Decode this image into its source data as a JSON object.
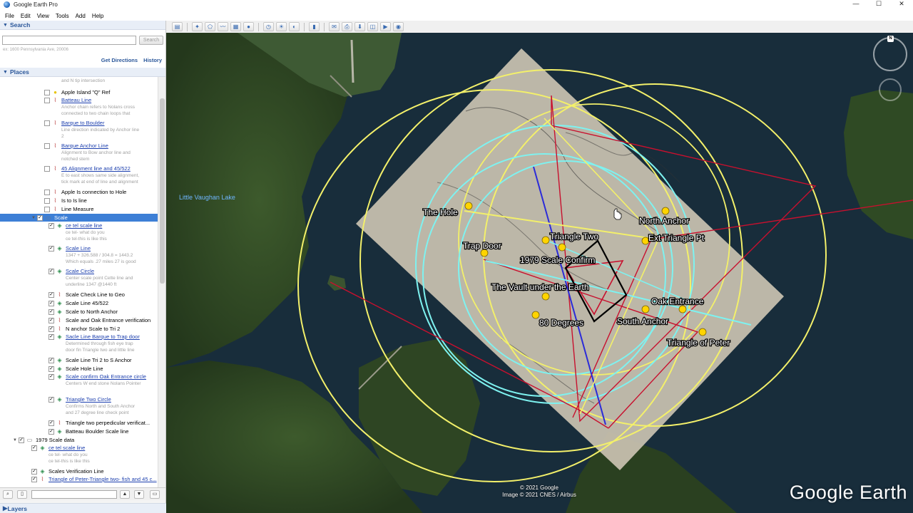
{
  "window": {
    "title": "Google Earth Pro",
    "controls": [
      "—",
      "☐",
      "✕"
    ]
  },
  "menu": [
    "File",
    "Edit",
    "View",
    "Tools",
    "Add",
    "Help"
  ],
  "search": {
    "header": "Search",
    "placeholder": "ex: 1600 Pennsylvania Ave, 20006",
    "button": "Search",
    "get_directions": "Get Directions",
    "history": "History"
  },
  "places": {
    "header": "Places",
    "top_desc": "and N tip intersection",
    "items": [
      {
        "label": "Apple Island \"Q\" Ref",
        "icon": "pin",
        "checked": false,
        "link": false,
        "desc": []
      },
      {
        "label": "Batteau Line",
        "icon": "path",
        "checked": false,
        "link": true,
        "desc": [
          "Anchor chain refers to Nolans cross",
          "connected to two chain loops that"
        ]
      },
      {
        "label": "Barque to Boulder",
        "icon": "path",
        "checked": false,
        "link": true,
        "desc": [
          "Line direction indicated by Anchor line",
          "2"
        ]
      },
      {
        "label": "Barque Anchor Line",
        "icon": "path",
        "checked": false,
        "link": true,
        "desc": [
          "Alignment to Bow anchor line and",
          "notched stern"
        ]
      },
      {
        "label": "45 Alignment line and 45/522",
        "icon": "path",
        "checked": false,
        "link": true,
        "desc": [
          "E to east shows same side alignment,",
          "tick mark at end of line and alignment"
        ]
      },
      {
        "label": "Apple Is connection to Hole",
        "icon": "path",
        "checked": false,
        "link": false,
        "desc": []
      },
      {
        "label": "Is to Is line",
        "icon": "path",
        "checked": false,
        "link": false,
        "desc": []
      },
      {
        "label": "Line Measure",
        "icon": "path",
        "checked": false,
        "link": false,
        "desc": []
      },
      {
        "label": "Scale",
        "icon": "folder",
        "checked": true,
        "link": false,
        "selected": true,
        "desc": []
      },
      {
        "label": "ce tel scale line",
        "icon": "poly",
        "checked": true,
        "link": true,
        "desc": [
          "ce tel- what do you",
          "ce tel-this is like this"
        ]
      },
      {
        "label": "Scale Line",
        "icon": "poly",
        "checked": true,
        "link": true,
        "desc": [
          "1347 + 326.588 / 304.8 = 1443.2",
          "Which equals .27 miles 27 is good"
        ]
      },
      {
        "label": "Scale Circle",
        "icon": "poly",
        "checked": true,
        "link": true,
        "desc": [
          "Center scale point Cette line and",
          "underline 1347 @1440 ft"
        ]
      },
      {
        "label": "Scale Check Line to Geo",
        "icon": "path",
        "checked": true,
        "link": false,
        "desc": []
      },
      {
        "label": "Scale Line 45/522",
        "icon": "poly",
        "checked": true,
        "link": false,
        "desc": []
      },
      {
        "label": "Scale to North Anchor",
        "icon": "poly",
        "checked": true,
        "link": false,
        "desc": []
      },
      {
        "label": "Scale and Oak Entrance verification",
        "icon": "path",
        "checked": true,
        "link": false,
        "desc": []
      },
      {
        "label": "N anchor Scale to Tri 2",
        "icon": "path",
        "checked": true,
        "link": false,
        "desc": []
      },
      {
        "label": "Sacle Line Barque to Trap door",
        "icon": "poly",
        "checked": true,
        "link": true,
        "desc": [
          "Determined through fish eye trap",
          "door fin Triangle two and little line"
        ]
      },
      {
        "label": "Scale Line Tri 2 to S Anchor",
        "icon": "poly",
        "checked": true,
        "link": false,
        "desc": []
      },
      {
        "label": "Scale Hole Line",
        "icon": "poly",
        "checked": true,
        "link": false,
        "desc": []
      },
      {
        "label": "Scale confirm Oak Entrance circle",
        "icon": "poly",
        "checked": true,
        "link": true,
        "desc": [
          "Centers W end stone Nolans Pointer"
        ]
      },
      {
        "label": "Triangle Two Circle",
        "icon": "poly",
        "checked": true,
        "link": true,
        "desc": [
          "Confirms North and South Anchor",
          "and 27 degree line check point"
        ]
      },
      {
        "label": "Triangle two perpedicular verificat...",
        "icon": "path",
        "checked": true,
        "link": false,
        "desc": []
      },
      {
        "label": "Batteau Boulder Scale line",
        "icon": "poly",
        "checked": true,
        "link": false,
        "desc": []
      },
      {
        "label": "1979 Scale data",
        "icon": "folder",
        "checked": true,
        "link": false,
        "desc": []
      },
      {
        "label": "ce tel scale line",
        "icon": "poly",
        "checked": true,
        "link": true,
        "desc": [
          "ce tel- what do you",
          "ce tel-this is like this"
        ]
      },
      {
        "label": "Scales Verification Line",
        "icon": "poly",
        "checked": true,
        "link": false,
        "desc": []
      },
      {
        "label": "Triangle of Peter-Triangle two- fish and 45 c...",
        "icon": "path",
        "checked": true,
        "link": true,
        "desc": []
      }
    ]
  },
  "layers": {
    "header": "Layers"
  },
  "map": {
    "lake_label": "Little Vaughan Lake",
    "labels": {
      "hole": "The Hole",
      "north_anchor": "North Anchor",
      "triangle_two": "Triangle Two",
      "ext_triangle": "Ext Triangle Pt",
      "trap_door": "Trap Door",
      "scale_confirm": "1979 Scale Confirm",
      "vault": "The Vault under the Earth",
      "oak": "Oak Entrance",
      "south_anchor": "South Anchor",
      "deg80": "80 Degrees",
      "peter": "Triangle of Peter"
    },
    "credit_1": "© 2021 Google",
    "credit_2": "Image © 2021 CNES / Airbus",
    "brand": "Google Earth",
    "north_marker": "N"
  },
  "colors": {
    "circle_yellow": "#f3f06a",
    "circle_cyan": "#7ef2f0",
    "line_red": "#c8102e",
    "line_blue": "#2b2bd8",
    "selection": "#3d7fd6",
    "link": "#1c3fae"
  }
}
